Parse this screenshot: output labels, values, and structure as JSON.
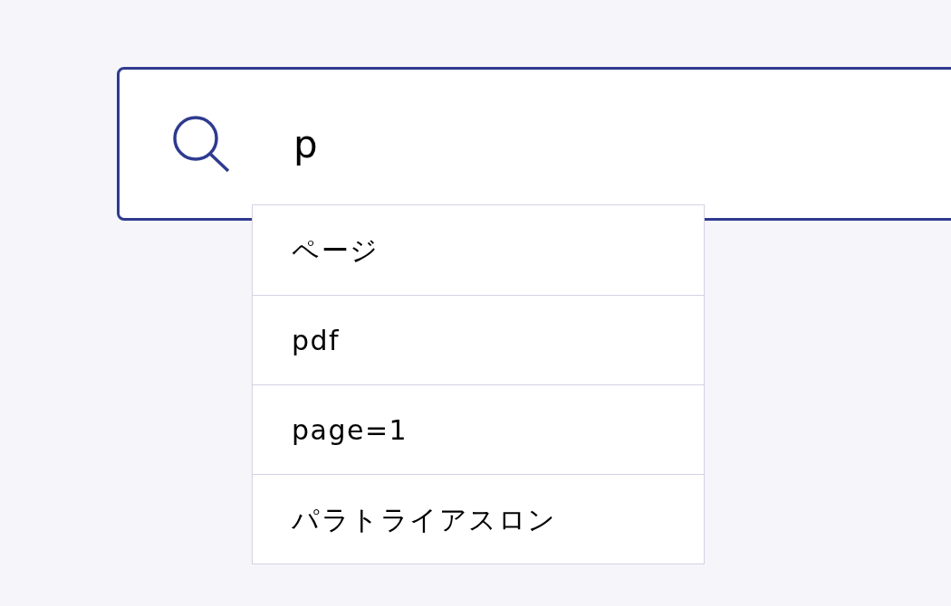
{
  "search": {
    "value": "p"
  },
  "suggestions": [
    {
      "label": "ページ"
    },
    {
      "label": "pdf"
    },
    {
      "label": "page=1"
    },
    {
      "label": "パラトライアスロン"
    }
  ]
}
